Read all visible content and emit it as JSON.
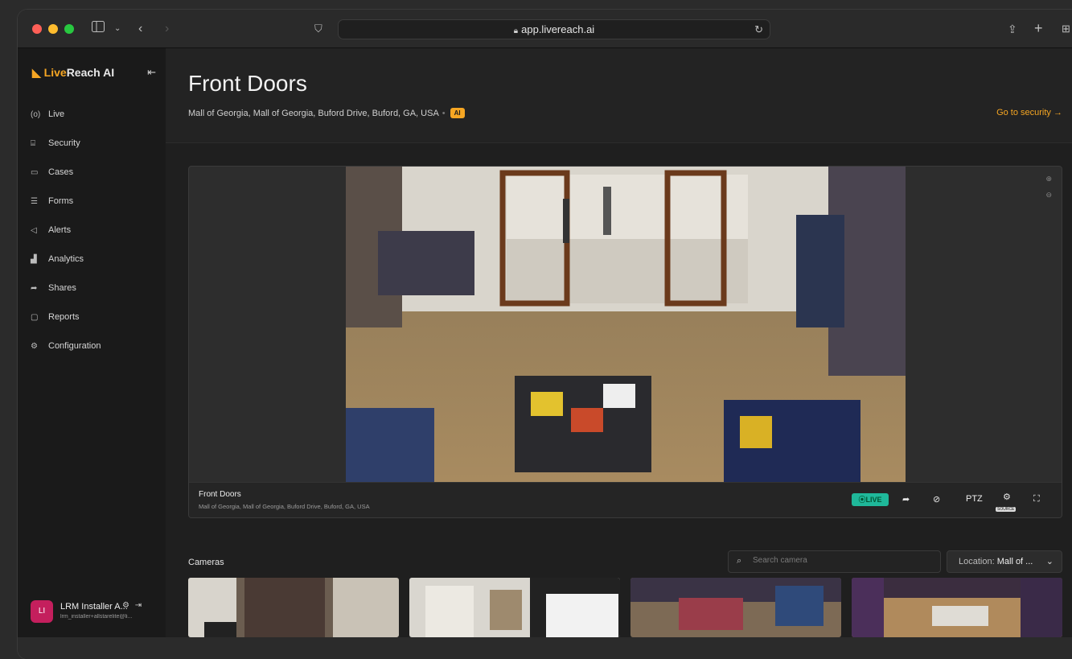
{
  "browser": {
    "url": "app.livereach.ai"
  },
  "sidebar": {
    "brand_prefix": "Live",
    "brand_suffix": "Reach AI",
    "items": [
      {
        "label": "Live",
        "icon": "live-icon"
      },
      {
        "label": "Security",
        "icon": "security-camera-icon"
      },
      {
        "label": "Cases",
        "icon": "folder-icon"
      },
      {
        "label": "Forms",
        "icon": "form-icon"
      },
      {
        "label": "Alerts",
        "icon": "megaphone-icon"
      },
      {
        "label": "Analytics",
        "icon": "bar-chart-icon"
      },
      {
        "label": "Shares",
        "icon": "share-icon"
      },
      {
        "label": "Reports",
        "icon": "report-icon"
      },
      {
        "label": "Configuration",
        "icon": "gear-icon"
      }
    ],
    "user": {
      "initials": "LI",
      "name": "LRM Installer A...",
      "email": "lrm_installer+allstarelite@li..."
    }
  },
  "header": {
    "title": "Front Doors",
    "location": "Mall of Georgia, Mall of Georgia, Buford Drive, Buford, GA, USA",
    "badge": "AI",
    "goto_link": "Go to security →"
  },
  "player": {
    "camera_name": "Front Doors",
    "camera_location": "Mall of Georgia, Mall of Georgia, Buford Drive, Buford, GA, USA",
    "live_label": "⦿LIVE",
    "ptz_label": "PTZ",
    "source_label": "SOURCE"
  },
  "cameras": {
    "label": "Cameras",
    "search_placeholder": "Search camera",
    "location_prefix": "Location:",
    "location_value": "Mall of ..."
  },
  "colors": {
    "accent": "#f6a623",
    "live": "#1fb89a",
    "avatar": "#c41f5d"
  }
}
